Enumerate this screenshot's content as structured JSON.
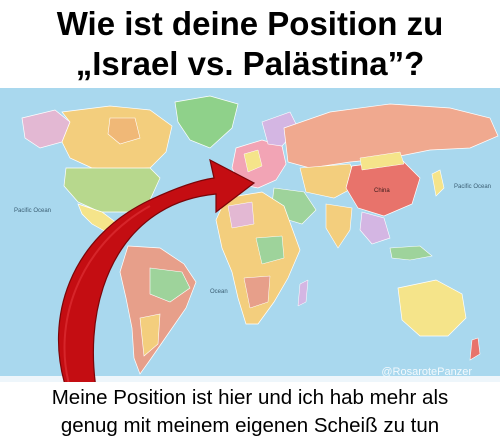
{
  "meme": {
    "title_line1": "Wie ist deine Position zu",
    "title_line2": "„Israel vs. Palästina”?",
    "caption_line1": "Meine Position ist hier und ich hab mehr als",
    "caption_line2": "genug mit meinem eigenen Scheiß zu tun",
    "watermark": "@RosarotePanzer"
  },
  "map": {
    "labels": {
      "pacific_left": "Pacific Ocean",
      "pacific_right": "Pacific Ocean",
      "indian": "Ocean",
      "china": "China"
    }
  },
  "colors": {
    "ocean": "#a9d8ee",
    "arrow": "#c40d12",
    "arrow_dark": "#7a0508"
  }
}
